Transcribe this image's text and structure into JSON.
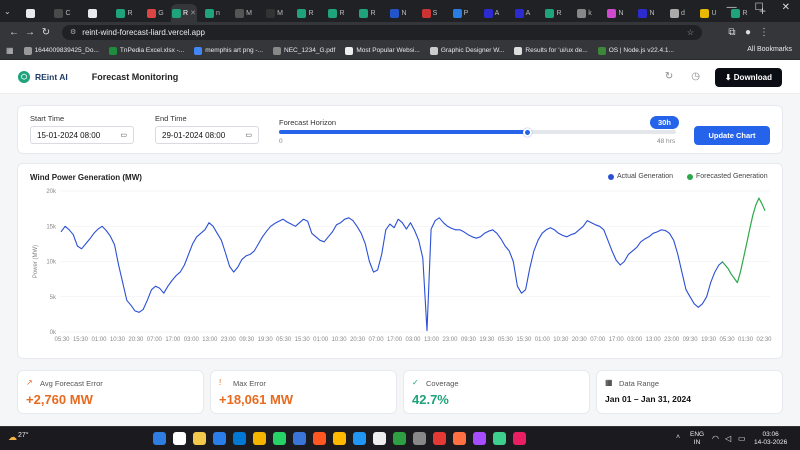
{
  "browser": {
    "tabs": [
      {
        "label": "",
        "color": "#e8eaed"
      },
      {
        "label": "C",
        "color": "#4a4a4a"
      },
      {
        "label": "",
        "color": "#e8eaed"
      },
      {
        "label": "R",
        "color": "#1ea37a"
      },
      {
        "label": "G",
        "color": "#d44"
      },
      {
        "label": "R",
        "color": "#1ea37a",
        "active": true
      },
      {
        "label": "n",
        "color": "#1ea37a"
      },
      {
        "label": "M",
        "color": "#555"
      },
      {
        "label": "M",
        "color": "#333"
      },
      {
        "label": "R",
        "color": "#1ea37a"
      },
      {
        "label": "R",
        "color": "#1ea37a"
      },
      {
        "label": "R",
        "color": "#1ea37a"
      },
      {
        "label": "N",
        "color": "#2255cc"
      },
      {
        "label": "S",
        "color": "#c33"
      },
      {
        "label": "P",
        "color": "#2a7de1"
      },
      {
        "label": "A",
        "color": "#2b2bd0"
      },
      {
        "label": "A",
        "color": "#2b2bd0"
      },
      {
        "label": "R",
        "color": "#1ea37a"
      },
      {
        "label": "k",
        "color": "#888"
      },
      {
        "label": "N",
        "color": "#d04ad0"
      },
      {
        "label": "N",
        "color": "#2b2bd0"
      },
      {
        "label": "d",
        "color": "#aaa"
      },
      {
        "label": "U",
        "color": "#e6b800"
      },
      {
        "label": "R",
        "color": "#1ea37a"
      }
    ],
    "url": "reint-wind-forecast-liard.vercel.app",
    "bookmarks": [
      {
        "label": "1644009839425_Do...",
        "color": "#999"
      },
      {
        "label": "TnPedia Excel.xlsx -...",
        "color": "#1e8e3e"
      },
      {
        "label": "memphis art png -...",
        "color": "#4285f4"
      },
      {
        "label": "NEC_1234_G.pdf",
        "color": "#888"
      },
      {
        "label": "Most Popular Websi...",
        "color": "#eee"
      },
      {
        "label": "Graphic Designer W...",
        "color": "#ccc"
      },
      {
        "label": "Results for 'ui/ux de...",
        "color": "#ddd"
      },
      {
        "label": "OS | Node.js v22.4.1...",
        "color": "#3c873a"
      }
    ],
    "all_bookmarks": "All Bookmarks"
  },
  "app": {
    "logo": "REint AI",
    "title": "Forecast Monitoring",
    "download_label": "Download"
  },
  "controls": {
    "start_label": "Start Time",
    "start_value": "15-01-2024 08:00",
    "end_label": "End Time",
    "end_value": "29-01-2024 08:00",
    "horizon_label": "Forecast Horizon",
    "horizon_badge": "30h",
    "horizon_value_hours": 30,
    "horizon_min": "0",
    "horizon_max": "48 hrs",
    "horizon_max_hours": 48,
    "update_label": "Update Chart"
  },
  "chart_data": {
    "type": "line",
    "title": "Wind Power Generation (MW)",
    "ylabel": "Power (MW)",
    "ylim": [
      0,
      20000
    ],
    "yticks": [
      "0k",
      "5k",
      "10k",
      "15k",
      "20k"
    ],
    "xticks": [
      "05:30",
      "15:30",
      "01:00",
      "10:30",
      "20:30",
      "07:00",
      "17:00",
      "03:00",
      "13:00",
      "23:00",
      "09:30",
      "19:30",
      "05:30",
      "15:30",
      "01:00",
      "10:30",
      "20:30",
      "07:00",
      "17:00",
      "03:00",
      "13:00",
      "23:00",
      "09:30",
      "19:30",
      "05:30",
      "15:30",
      "01:00",
      "10:30",
      "20:30",
      "07:00",
      "17:00",
      "03:00",
      "13:00",
      "23:00",
      "09:30",
      "19:30",
      "05:30",
      "01:30",
      "02:30"
    ],
    "legend_position": "top-right",
    "series": [
      {
        "name": "Actual Generation",
        "color": "#2b50d4",
        "values": [
          14200,
          15000,
          14500,
          13800,
          12200,
          11800,
          12500,
          13200,
          14000,
          14600,
          15000,
          14400,
          13600,
          12400,
          9500,
          7000,
          4500,
          3800,
          3000,
          2800,
          3200,
          4500,
          6000,
          6500,
          6200,
          5500,
          6500,
          7300,
          8000,
          8500,
          9500,
          11000,
          12500,
          13500,
          14000,
          14500,
          15500,
          15000,
          14000,
          13000,
          11200,
          9300,
          8500,
          9200,
          10300,
          10800,
          11000,
          11500,
          12500,
          13500,
          14300,
          15000,
          15400,
          15700,
          16000,
          15600,
          15300,
          15000,
          15500,
          16000,
          15700,
          14000,
          13500,
          13000,
          12800,
          13500,
          14200,
          15200,
          15500,
          16000,
          16200,
          15800,
          15000,
          14000,
          12500,
          10000,
          8500,
          8800,
          11000,
          14500,
          15300,
          14800,
          16000,
          15500,
          14600,
          15500,
          14400,
          13000,
          10500,
          200,
          14600,
          15800,
          16200,
          15500,
          15000,
          14700,
          14500,
          14500,
          14200,
          13800,
          13500,
          13300,
          13500,
          14000,
          14300,
          14500,
          14000,
          13200,
          12200,
          11500,
          10000,
          6500,
          5500,
          6000,
          9000,
          11500,
          13000,
          14000,
          14500,
          14800,
          14500,
          14000,
          13700,
          13500,
          13800,
          14000,
          14500,
          15000,
          15800,
          15500,
          15200,
          15000,
          14500,
          13000,
          11500,
          10200,
          9500,
          10000,
          11000,
          11500,
          12000,
          12800,
          13200,
          13500,
          14000,
          14200,
          14500,
          14400,
          14000,
          13000,
          11000,
          8500,
          6000,
          5000,
          4000,
          3500,
          4000,
          5000,
          7000,
          8500,
          9500,
          10000
        ]
      },
      {
        "name": "Forecasted Generation",
        "color": "#2ca84a",
        "values": [
          10000,
          9500,
          9000,
          8200,
          7600,
          7000,
          8500,
          10500,
          12500,
          14500,
          16500,
          18000,
          19000,
          18200,
          17200
        ]
      }
    ]
  },
  "stats": [
    {
      "label": "Avg Forecast Error",
      "value": "+2,760 MW",
      "color": "#e86a1f",
      "icon": "info-icon"
    },
    {
      "label": "Max Error",
      "value": "+18,061 MW",
      "color": "#e86a1f",
      "icon": "warning-icon"
    },
    {
      "label": "Coverage",
      "value": "42.7%",
      "color": "#1ea37a",
      "icon": "check-icon"
    },
    {
      "label": "Data Range",
      "value": "Jan 01 – Jan 31, 2024",
      "color": "#111",
      "icon": "calendar-icon"
    }
  ],
  "taskbar": {
    "weather": "27°",
    "lang_1": "ENG",
    "lang_2": "IN",
    "time": "03:06",
    "date": "14-03-2026"
  }
}
